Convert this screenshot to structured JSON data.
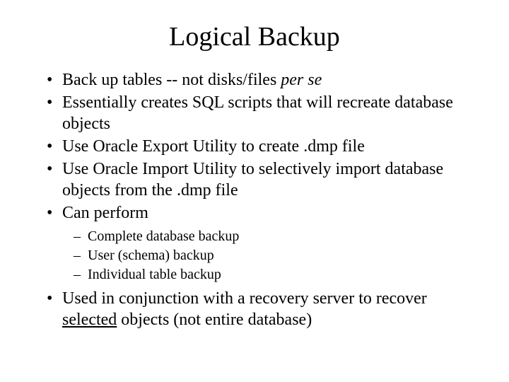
{
  "title": "Logical Backup",
  "bullets": {
    "b0_pre": "Back up tables -- not disks/files ",
    "b0_italic": "per se",
    "b1": "Essentially creates SQL scripts that will recreate database objects",
    "b2": "Use Oracle Export Utility to create .dmp file",
    "b3": "Use Oracle Import Utility to selectively import database objects from the .dmp file",
    "b4": "Can perform",
    "sub0": "Complete database backup",
    "sub1": "User (schema) backup",
    "sub2": "Individual table backup",
    "b5_pre": "Used in conjunction with a recovery server to recover ",
    "b5_under": "selected",
    "b5_post": " objects (not entire database)"
  }
}
